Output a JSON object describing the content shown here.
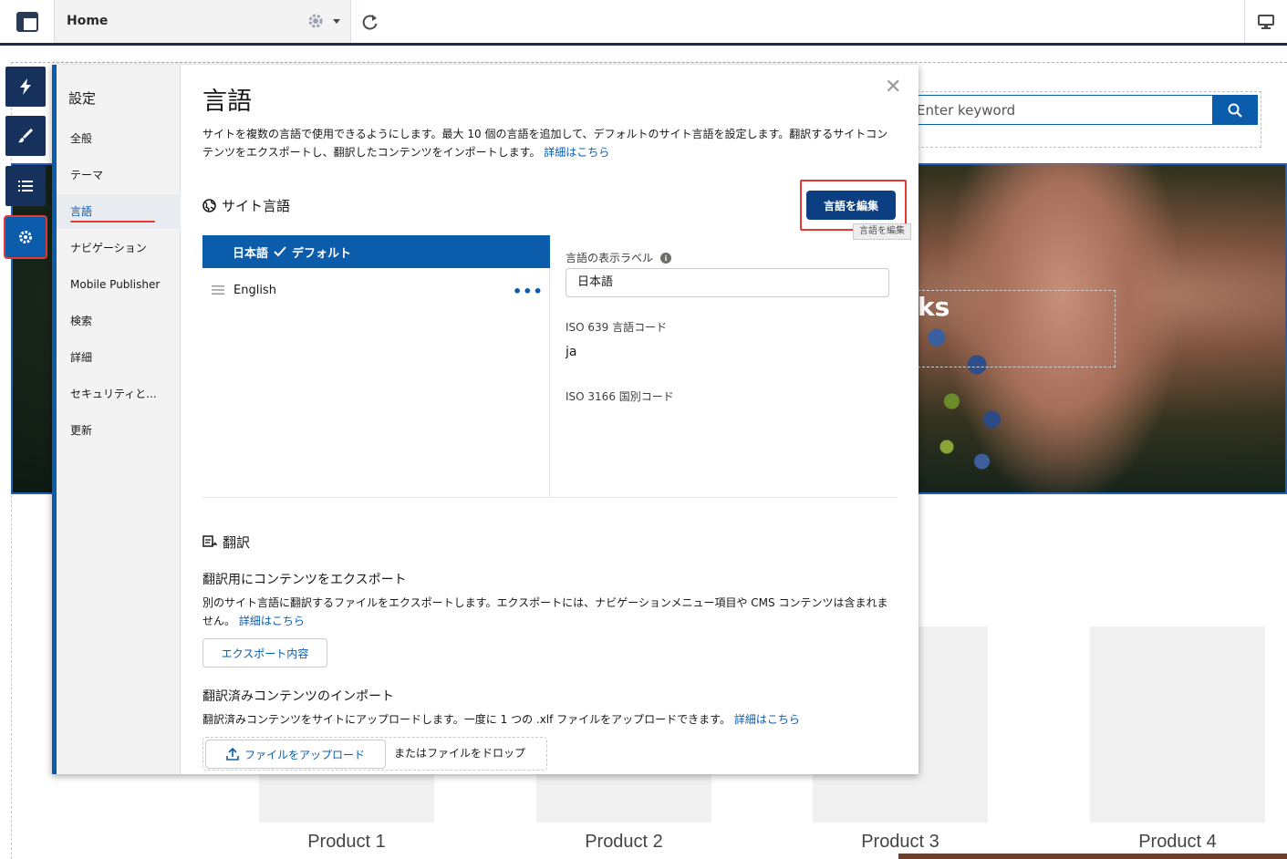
{
  "topbar": {
    "home_label": "Home",
    "icons": {
      "app": "layout-icon",
      "gear": "gear-icon",
      "caret": "caret-down-icon",
      "refresh": "refresh-icon",
      "device": "desktop-icon"
    }
  },
  "site": {
    "search_placeholder": "Enter keyword",
    "hero_text": "ks",
    "products": [
      "Product 1",
      "Product 2",
      "Product 3",
      "Product 4"
    ]
  },
  "rail": {
    "items": [
      {
        "name": "lightning-icon"
      },
      {
        "name": "brush-icon"
      },
      {
        "name": "list-icon"
      },
      {
        "name": "settings-icon",
        "active": true
      }
    ]
  },
  "settings": {
    "nav_title": "設定",
    "nav_items": [
      {
        "label": "全般"
      },
      {
        "label": "テーマ"
      },
      {
        "label": "言語",
        "active": true
      },
      {
        "label": "ナビゲーション"
      },
      {
        "label": "Mobile Publisher"
      },
      {
        "label": "検索"
      },
      {
        "label": "詳細"
      },
      {
        "label": "セキュリティと..."
      },
      {
        "label": "更新"
      }
    ],
    "page_title": "言語",
    "description": "サイトを複数の言語で使用できるようにします。最大 10 個の言語を追加して、デフォルトのサイト言語を設定します。翻訳するサイトコンテンツをエクスポートし、翻訳したコンテンツをインポートします。",
    "details_link": "詳細はこちら",
    "site_languages_heading": "サイト言語",
    "edit_button": "言語を編集",
    "edit_tooltip": "言語を編集",
    "languages": [
      {
        "label": "日本語",
        "default_label": "デフォルト",
        "selected": true
      },
      {
        "label": "English"
      }
    ],
    "detail": {
      "display_label_caption": "言語の表示ラベル",
      "display_label_value": "日本語",
      "iso639_caption": "ISO 639 言語コード",
      "iso639_value": "ja",
      "iso3166_caption": "ISO 3166 国別コード"
    },
    "translation": {
      "heading": "翻訳",
      "export_heading": "翻訳用にコンテンツをエクスポート",
      "export_desc": "別のサイト言語に翻訳するファイルをエクスポートします。エクスポートには、ナビゲーションメニュー項目や CMS コンテンツは含まれません。",
      "export_link": "詳細はこちら",
      "export_button": "エクスポート内容",
      "import_heading": "翻訳済みコンテンツのインポート",
      "import_desc": "翻訳済みコンテンツをサイトにアップロードします。一度に 1 つの .xlf ファイルをアップロードできます。",
      "import_link": "詳細はこちら",
      "upload_button": "ファイルをアップロード",
      "drop_text": "またはファイルをドロップ"
    }
  },
  "colors": {
    "brand": "#0b5cab",
    "dark_brand": "#16325c",
    "highlight": "#e53935"
  }
}
